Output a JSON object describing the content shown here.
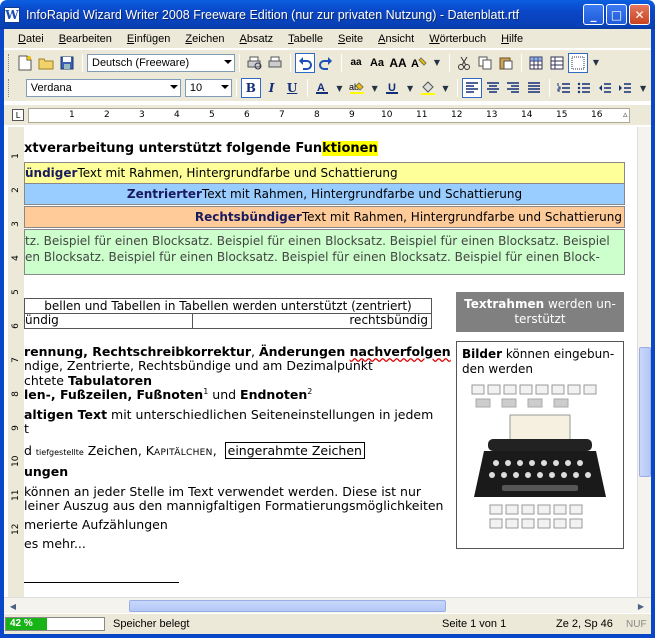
{
  "window": {
    "title": "InfoRapid Wizard Writer 2008 Freeware Edition (nur zur privaten Nutzung) - Datenblatt.rtf",
    "icon": "W",
    "minimize": "_",
    "maximize": "□",
    "close": "✕"
  },
  "menu": [
    "Datei",
    "Bearbeiten",
    "Einfügen",
    "Zeichen",
    "Absatz",
    "Tabelle",
    "Seite",
    "Ansicht",
    "Wörterbuch",
    "Hilfe"
  ],
  "toolbar1": {
    "language": "Deutsch (Freeware)",
    "case_buttons": [
      "aa",
      "Aa",
      "AA"
    ]
  },
  "toolbar2": {
    "font": "Verdana",
    "size": "10",
    "bold": "B",
    "italic": "I",
    "underline": "U"
  },
  "ruler": {
    "labels": [
      "1",
      "2",
      "3",
      "4",
      "5",
      "6",
      "7",
      "8",
      "9",
      "10",
      "11",
      "12",
      "13",
      "14",
      "15",
      "16"
    ],
    "vlabels": [
      "1",
      "2",
      "3",
      "4",
      "5",
      "6",
      "7",
      "8",
      "9",
      "10",
      "11",
      "12"
    ]
  },
  "document": {
    "heading_a": "xtverarbeitung unterstützt folgende Fun",
    "heading_b": "ktionen",
    "band1_bold": "ündiger",
    "band1_rest": " Text mit Rahmen, Hintergrundfarbe und Schattierung",
    "band2_bold": "Zentrierter",
    "band2_rest": " Text mit Rahmen, Hintergrundfarbe und Schattierung",
    "band3_bold": "Rechtsbündiger",
    "band3_rest": " Text mit Rahmen, Hintergrundfarbe und Schattierung",
    "block1": "tz. Beispiel für einen Blocksatz. Beispiel für einen Blocksatz. Beispiel für einen Blocksatz. Beispiel",
    "block2": "en Blocksatz. Beispiel für einen Blocksatz. Beispiel für einen Blocksatz. Beispiel für einen Block-",
    "table_header": "bellen und Tabellen in Tabellen werden unterstützt (zentriert)",
    "table_left": "ündig",
    "table_right": "rechtsbündig",
    "frame_bold": "Textrahmen",
    "frame_rest": " werden un-",
    "frame_line2": "terstützt",
    "img_bold": "Bilder",
    "img_rest": " können eingebun-",
    "img_line2": "den werden",
    "l1_bold1": "rennung, Rechtschreibkorrektur",
    "l1_sep": ", ",
    "l1_bold2": "Änderungen ",
    "l1_wavy": "nachverfolgen",
    "l2": "ndige, Zentrierte, Rechtsbündige und am Dezimalpunkt",
    "l3_pre": "chtete ",
    "l3_bold": "Tabulatoren",
    "l4_bold1": "len-, Fußzeilen, Fußnoten",
    "l4_sup1": "1",
    "l4_mid": " und ",
    "l4_bold2": "Endnoten",
    "l4_sup2": "2",
    "l5_bold": "altigen Text",
    "l5_rest": " mit unterschiedlichen Seiteneinstellungen in jedem",
    "l6": "t",
    "l7_pre": "d ",
    "l7_tiny": "tiefgestellte",
    "l7_mid": " Zeichen, K",
    "l7_sc": "APITÄLCHEN",
    "l7_comma": ",",
    "l7_box": "eingerahmte Zeichen",
    "l8_bold": "ungen",
    "l9": " können an jeder Stelle im Text verwendet werden. Diese ist nur",
    "l10": "leiner Auszug aus den mannigfaltigen Formatierungsmöglichkeiten",
    "l11": "merierte Aufzählungen",
    "l12": "es mehr..."
  },
  "status": {
    "progress_pct": 42,
    "progress_label": "42 %",
    "memory": "Speicher belegt",
    "page": "Seite 1 von 1",
    "position": "Ze 2, Sp 46",
    "mode": "NUF"
  },
  "colors": {
    "band1": "#ffff99",
    "band2": "#99ccff",
    "band3": "#ffcc99",
    "band4": "#ccffcc",
    "highlight": "#ffff00",
    "textframe": "#808080"
  }
}
